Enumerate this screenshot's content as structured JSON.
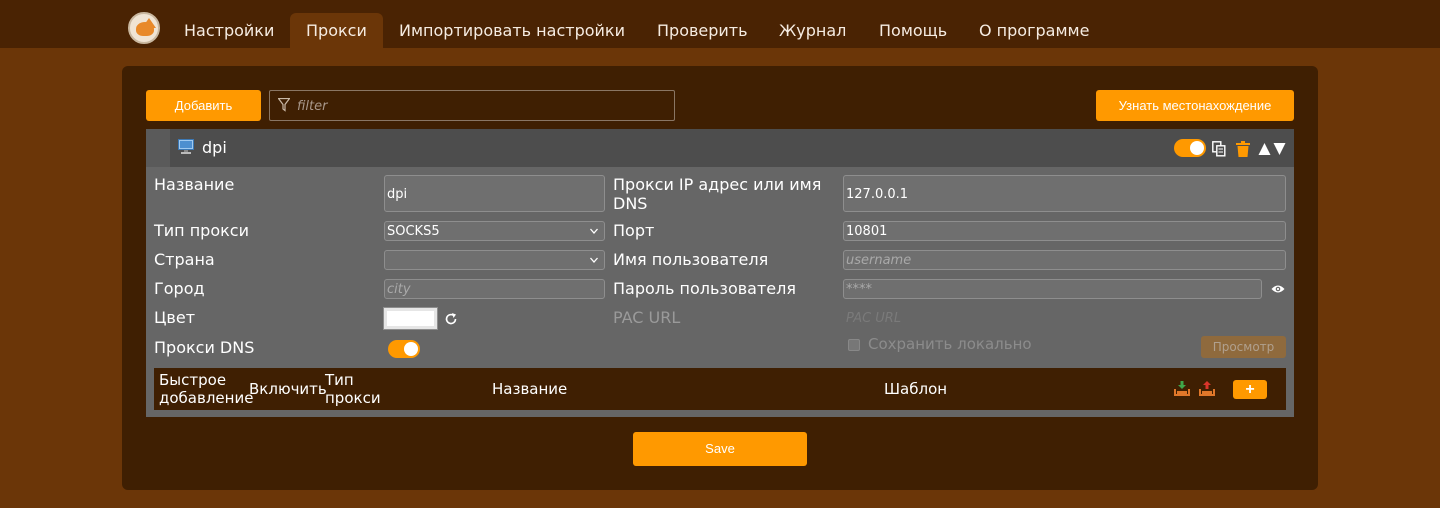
{
  "nav": {
    "items": [
      {
        "label": "Настройки"
      },
      {
        "label": "Прокси"
      },
      {
        "label": "Импортировать настройки"
      },
      {
        "label": "Проверить"
      },
      {
        "label": "Журнал"
      },
      {
        "label": "Помощь"
      },
      {
        "label": "О программе"
      }
    ],
    "active_index": 1
  },
  "toolbar": {
    "add_label": "Добавить",
    "filter_placeholder": "filter",
    "locate_label": "Узнать местонахождение"
  },
  "proxy": {
    "title": "dpi",
    "enabled": true,
    "fields": {
      "name_label": "Название",
      "name_value": "dpi",
      "host_label": "Прокси IP адрес или имя DNS",
      "host_value": "127.0.0.1",
      "type_label": "Тип прокси",
      "type_value": "SOCKS5",
      "port_label": "Порт",
      "port_value": "10801",
      "country_label": "Страна",
      "country_value": "",
      "username_label": "Имя пользователя",
      "username_placeholder": "username",
      "city_label": "Город",
      "city_placeholder": "city",
      "password_label": "Пароль пользователя",
      "password_placeholder": "****",
      "color_label": "Цвет",
      "color_value": "#ffffff",
      "pac_label": "PAC URL",
      "pac_placeholder": "PAC URL",
      "dns_label": "Прокси DNS",
      "dns_enabled": true,
      "store_locally_label": "Сохранить локально",
      "view_label": "Просмотр"
    },
    "patterns_header": {
      "quick_add": "Быстрое добавление",
      "enable": "Включить",
      "proxy_type": "Тип прокси",
      "name": "Название",
      "template": "Шаблон",
      "add_symbol": "+"
    }
  },
  "save_label": "Save",
  "colors": {
    "accent": "#ff9900",
    "background": "#6b3608",
    "panel": "#3f1f02",
    "card": "#666666"
  }
}
